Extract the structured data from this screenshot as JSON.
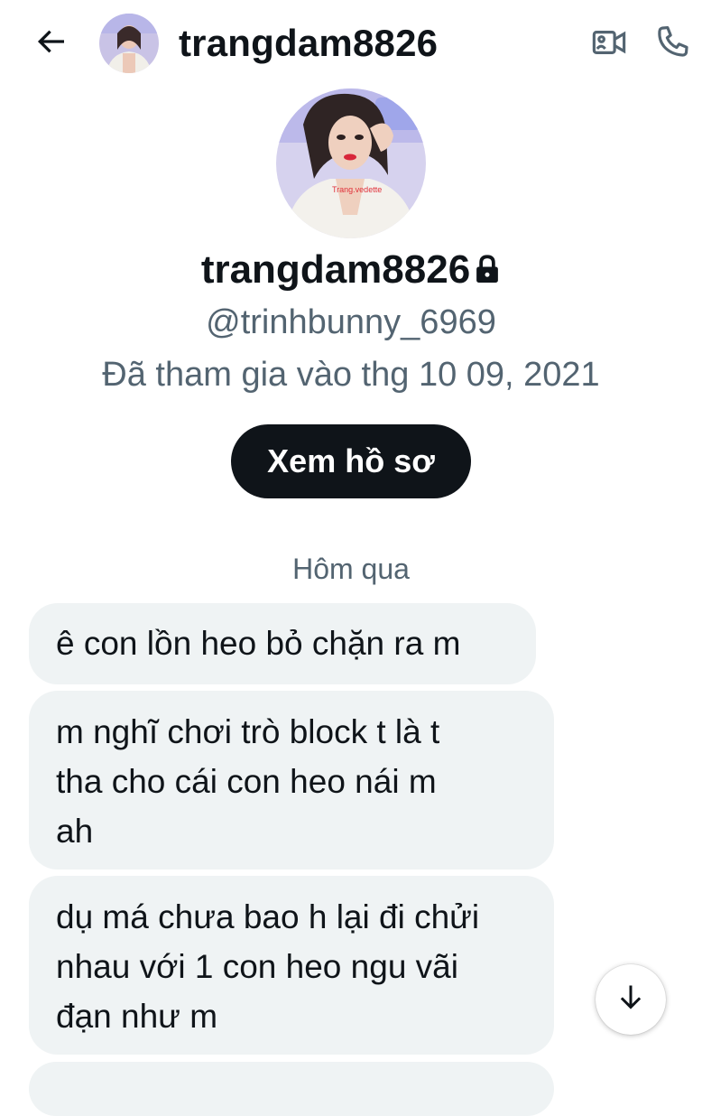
{
  "header": {
    "back_icon": "arrow-left-icon",
    "title": "trangdam8826",
    "video_icon": "video-call-icon",
    "phone_icon": "phone-call-icon"
  },
  "profile": {
    "avatar_caption": "Trang.vedette",
    "display_name": "trangdam8826",
    "lock_icon": "lock-icon",
    "handle": "@trinhbunny_6969",
    "joined": "Đã tham gia vào thg 10 09, 2021",
    "view_profile_label": "Xem hồ sơ"
  },
  "conversation": {
    "day_separator": "Hôm qua",
    "messages": [
      {
        "lines": [
          "ê con lồn heo bỏ chặn ra m"
        ]
      },
      {
        "lines": [
          "m nghĩ chơi trò block t là t",
          "tha cho cái con heo nái m",
          "ah"
        ]
      },
      {
        "lines": [
          "dụ má chưa bao h lại đi chửi",
          "nhau với 1 con heo ngu vãi",
          "đạn như m"
        ]
      }
    ],
    "scroll_down_icon": "arrow-down-icon"
  },
  "colors": {
    "primary_text": "#0f1419",
    "secondary_text": "#536471",
    "bubble_bg": "#eff3f4",
    "button_bg": "#0f1419"
  }
}
